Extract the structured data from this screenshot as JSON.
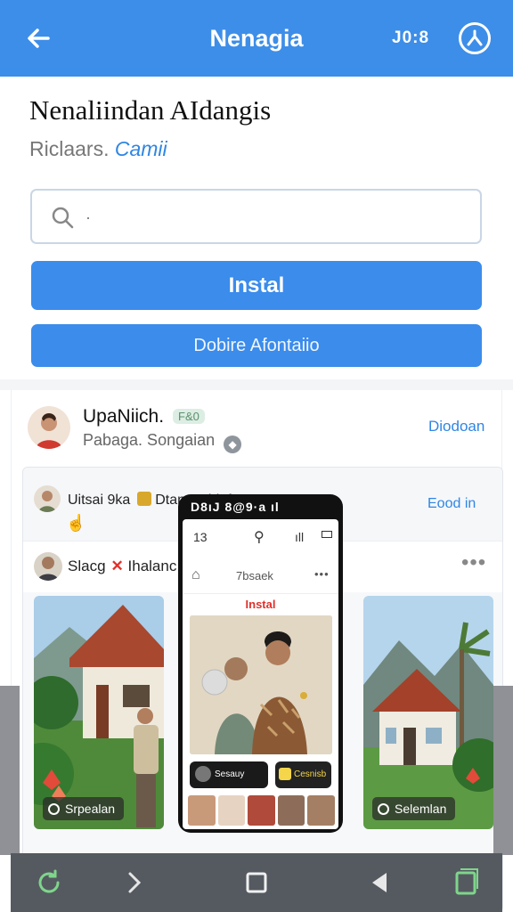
{
  "app_bar": {
    "title": "Nenagia",
    "status": "J0:8",
    "back_icon": "back-arrow-icon",
    "account_icon": "account-circle-icon"
  },
  "header": {
    "title": "Nenaliindan AIdangis",
    "subtitle_prefix": "Riclaars.",
    "subtitle_link": "Camii"
  },
  "search": {
    "placeholder": "·",
    "value": ""
  },
  "buttons": {
    "primary": "Instal",
    "secondary": "Dobire Afontaiio"
  },
  "post": {
    "user_name": "UpaNiich.",
    "badge": "F&0",
    "meta": "Pabaga. Songaian",
    "follow_link": "Diodoan",
    "inner": {
      "mini_user": "Uitsai 9ka",
      "mini_user_suffix": "Dtanaashiuf",
      "good_link": "Eood in",
      "post_author": "Slacg",
      "post_author_suffix": "Ihalanc",
      "more": "•••",
      "photo_left_chip": "Srpealan",
      "photo_right_chip": "Selemlan"
    }
  },
  "phone": {
    "status": "D8ıJ 8@⁠9·a ıl",
    "top_left": "13",
    "top_signal": "ıll",
    "nav_title": "7bsaek",
    "nav_more": "•••",
    "install_label": "Instal",
    "pill_left": "Sesauy",
    "pill_right": "Cesnisb"
  },
  "colors": {
    "accent": "#3d8ee8",
    "button": "#3b8ceb",
    "link": "#2f86e4",
    "nav": "#555a61"
  },
  "navbar": {
    "icons": [
      "refresh-icon",
      "forward-icon",
      "square-home-icon",
      "back-triangle-icon",
      "recent-apps-icon"
    ]
  }
}
